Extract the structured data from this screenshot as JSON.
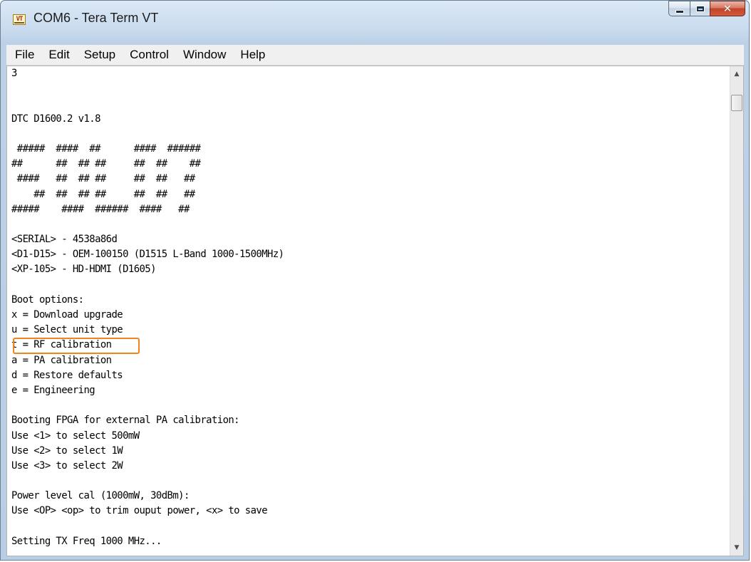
{
  "window": {
    "title": "COM6 - Tera Term VT",
    "app_icon_text": "VT"
  },
  "menu": [
    "File",
    "Edit",
    "Setup",
    "Control",
    "Window",
    "Help"
  ],
  "terminal": {
    "lines": [
      "3",
      "",
      "",
      "DTC D1600.2 v1.8",
      "",
      " #####  ####  ##      ####  ######",
      "##      ##  ## ##     ##  ##    ##",
      " ####   ##  ## ##     ##  ##   ##",
      "    ##  ##  ## ##     ##  ##   ##",
      "#####    ####  ######  ####   ##",
      "",
      "<SERIAL> - 4538a86d",
      "<D1-D15> - OEM-100150 (D1515 L-Band 1000-1500MHz)",
      "<XP-105> - HD-HDMI (D1605)",
      "",
      "Boot options:",
      "x = Download upgrade",
      "u = Select unit type",
      "t = RF calibration",
      "a = PA calibration",
      "d = Restore defaults",
      "e = Engineering",
      "",
      "Booting FPGA for external PA calibration:",
      "Use <1> to select 500mW",
      "Use <2> to select 1W",
      "Use <3> to select 2W",
      "",
      "Power level cal (1000mW, 30dBm):",
      "Use <OP> <op> to trim ouput power, <x> to save",
      "",
      "Setting TX Freq 1000 MHz..."
    ],
    "highlighted_line": "a = PA calibration",
    "highlight_color": "#f0851e"
  },
  "scrollbar": {
    "up_arrow": "▲",
    "down_arrow": "▼"
  }
}
